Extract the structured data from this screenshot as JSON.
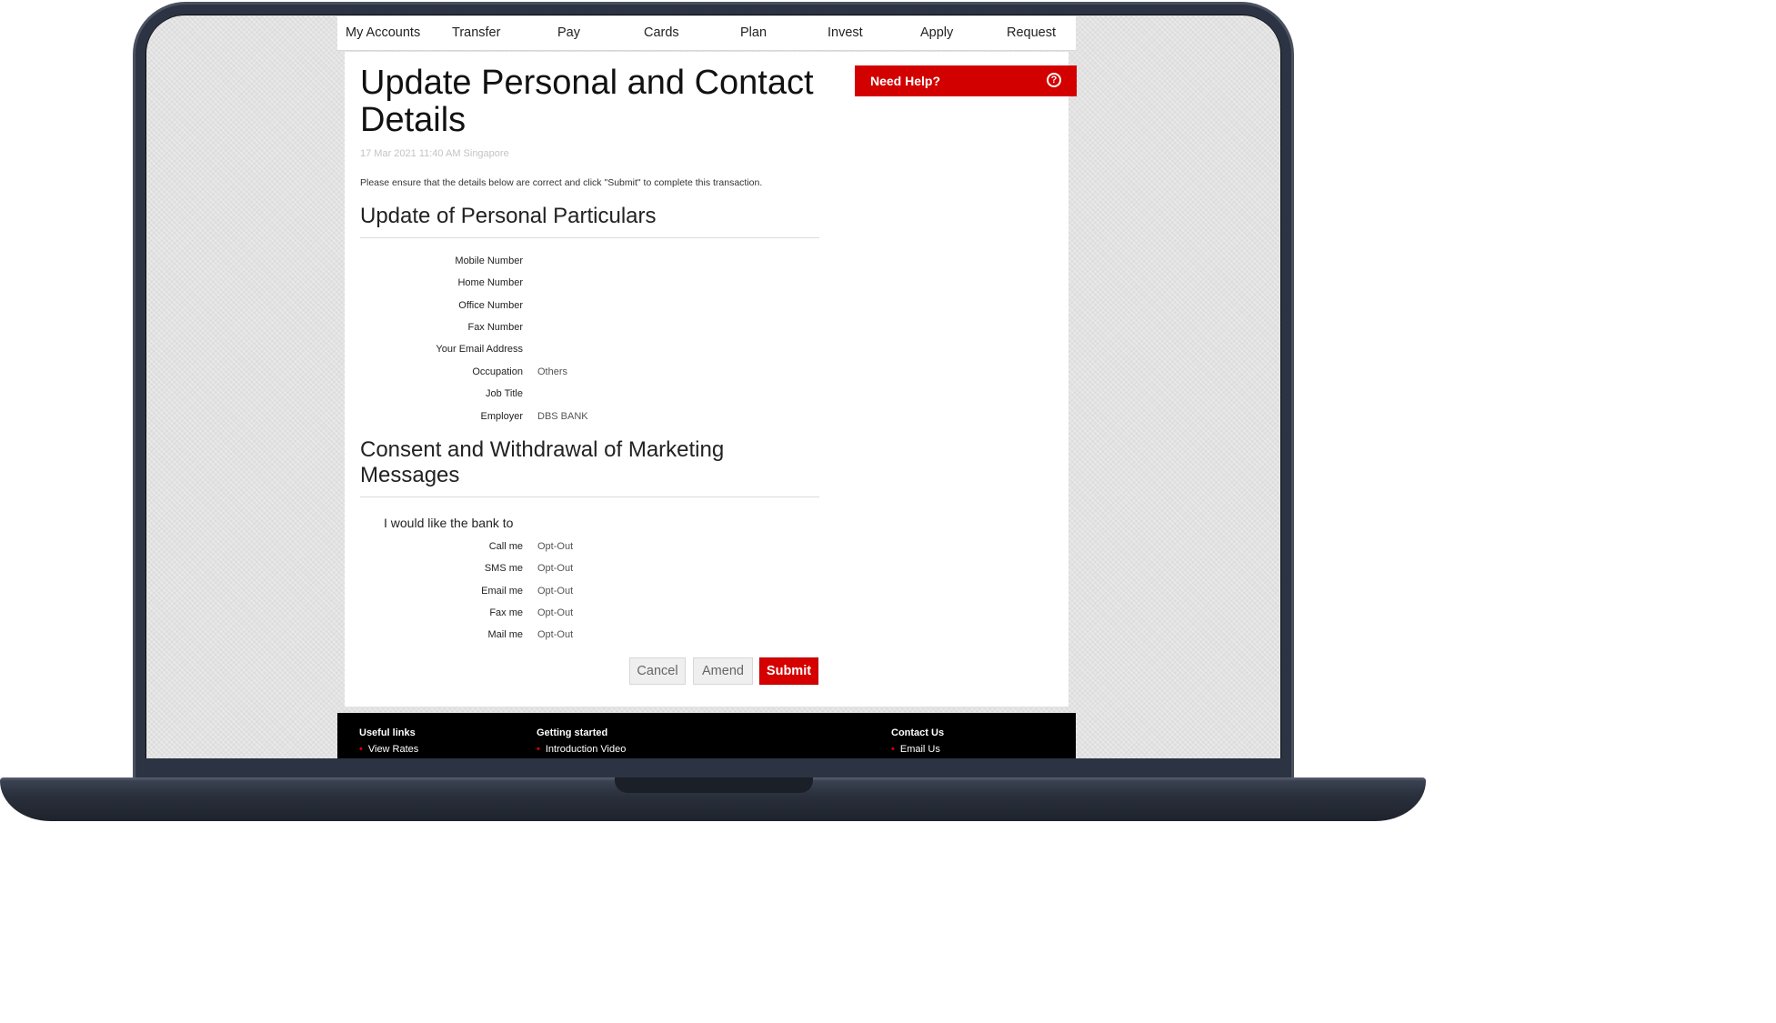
{
  "nav": {
    "items": [
      "My Accounts",
      "Transfer",
      "Pay",
      "Cards",
      "Plan",
      "Invest",
      "Apply",
      "Request"
    ]
  },
  "page": {
    "title": "Update Personal and Contact Details",
    "timestamp": "17 Mar 2021 11:40 AM Singapore",
    "instruction": "Please ensure that the details below are correct and click \"Submit\" to complete this transaction."
  },
  "personal": {
    "heading": "Update of Personal Particulars",
    "fields": [
      {
        "label": "Mobile Number",
        "value": ""
      },
      {
        "label": "Home Number",
        "value": ""
      },
      {
        "label": "Office Number",
        "value": ""
      },
      {
        "label": "Fax Number",
        "value": ""
      },
      {
        "label": "Your Email Address",
        "value": ""
      },
      {
        "label": "Occupation",
        "value": "Others"
      },
      {
        "label": "Job Title",
        "value": ""
      },
      {
        "label": "Employer",
        "value": "DBS BANK"
      }
    ]
  },
  "consent": {
    "heading": "Consent and Withdrawal of Marketing Messages",
    "intro": "I would like the bank to",
    "fields": [
      {
        "label": "Call me",
        "value": "Opt-Out"
      },
      {
        "label": "SMS me",
        "value": "Opt-Out"
      },
      {
        "label": "Email me",
        "value": "Opt-Out"
      },
      {
        "label": "Fax me",
        "value": "Opt-Out"
      },
      {
        "label": "Mail me",
        "value": "Opt-Out"
      }
    ]
  },
  "actions": {
    "cancel": "Cancel",
    "amend": "Amend",
    "submit": "Submit"
  },
  "help": {
    "label": "Need Help?",
    "icon": "question-circle-icon"
  },
  "footer": {
    "cols": [
      {
        "heading": "Useful links",
        "link": "View Rates"
      },
      {
        "heading": "Getting started",
        "link": "Introduction Video"
      },
      {
        "heading": "Contact Us",
        "link": "Email Us"
      }
    ]
  },
  "colors": {
    "brand_red": "#d30000",
    "footer_bg": "#000000"
  }
}
